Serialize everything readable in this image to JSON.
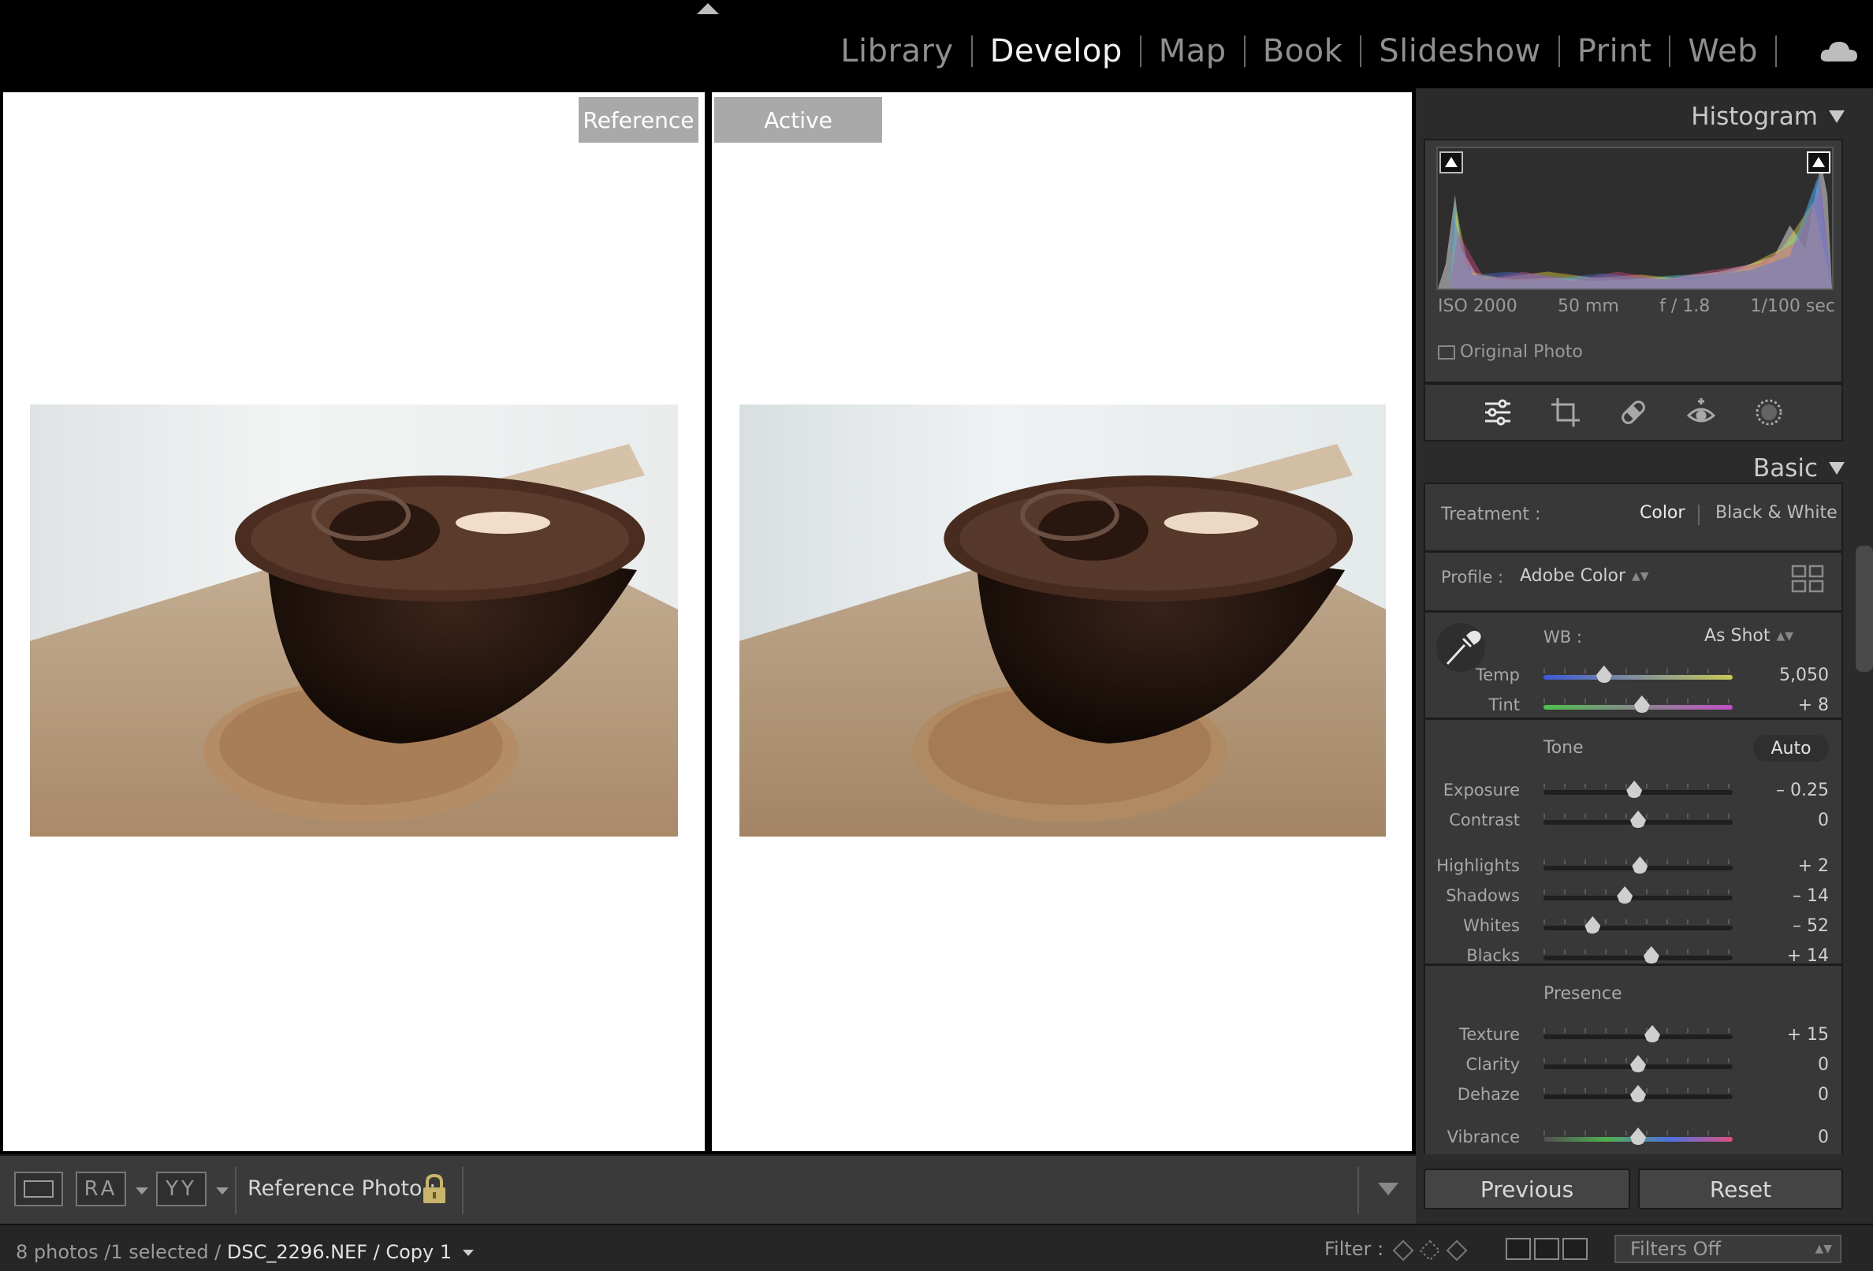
{
  "modules": {
    "items": [
      "Library",
      "Develop",
      "Map",
      "Book",
      "Slideshow",
      "Print",
      "Web"
    ],
    "active": "Develop"
  },
  "compare": {
    "reference_label": "Reference",
    "active_label": "Active"
  },
  "histogram": {
    "title": "Histogram",
    "iso": "ISO 2000",
    "focal": "50 mm",
    "aperture": "f / 1.8",
    "shutter": "1/100 sec",
    "original_photo": "Original Photo"
  },
  "basic": {
    "title": "Basic",
    "treatment_label": "Treatment :",
    "treatment_color": "Color",
    "treatment_bw": "Black & White",
    "profile_label": "Profile :",
    "profile_value": "Adobe Color",
    "wb_label": "WB :",
    "wb_value": "As Shot",
    "tone_label": "Tone",
    "auto_label": "Auto",
    "presence_label": "Presence",
    "sliders": {
      "temp": {
        "label": "Temp",
        "value": "5,050",
        "pos": 0.32
      },
      "tint": {
        "label": "Tint",
        "value": "+ 8",
        "pos": 0.52
      },
      "exposure": {
        "label": "Exposure",
        "value": "– 0.25",
        "pos": 0.48
      },
      "contrast": {
        "label": "Contrast",
        "value": "0",
        "pos": 0.5
      },
      "highlights": {
        "label": "Highlights",
        "value": "+ 2",
        "pos": 0.51
      },
      "shadows": {
        "label": "Shadows",
        "value": "– 14",
        "pos": 0.43
      },
      "whites": {
        "label": "Whites",
        "value": "– 52",
        "pos": 0.26
      },
      "blacks": {
        "label": "Blacks",
        "value": "+ 14",
        "pos": 0.57
      },
      "texture": {
        "label": "Texture",
        "value": "+ 15",
        "pos": 0.575
      },
      "clarity": {
        "label": "Clarity",
        "value": "0",
        "pos": 0.5
      },
      "dehaze": {
        "label": "Dehaze",
        "value": "0",
        "pos": 0.5
      },
      "vibrance": {
        "label": "Vibrance",
        "value": "0",
        "pos": 0.5
      }
    }
  },
  "toolbar": {
    "ref_photo_label": "Reference Photo :",
    "ra_label": "RA",
    "yy_label": "YY"
  },
  "buttons": {
    "previous": "Previous",
    "reset": "Reset"
  },
  "filmstrip": {
    "count_text": "8 photos /1 selected /",
    "file": "DSC_2296.NEF / Copy 1",
    "filter_label": "Filter :",
    "filter_value": "Filters Off"
  }
}
